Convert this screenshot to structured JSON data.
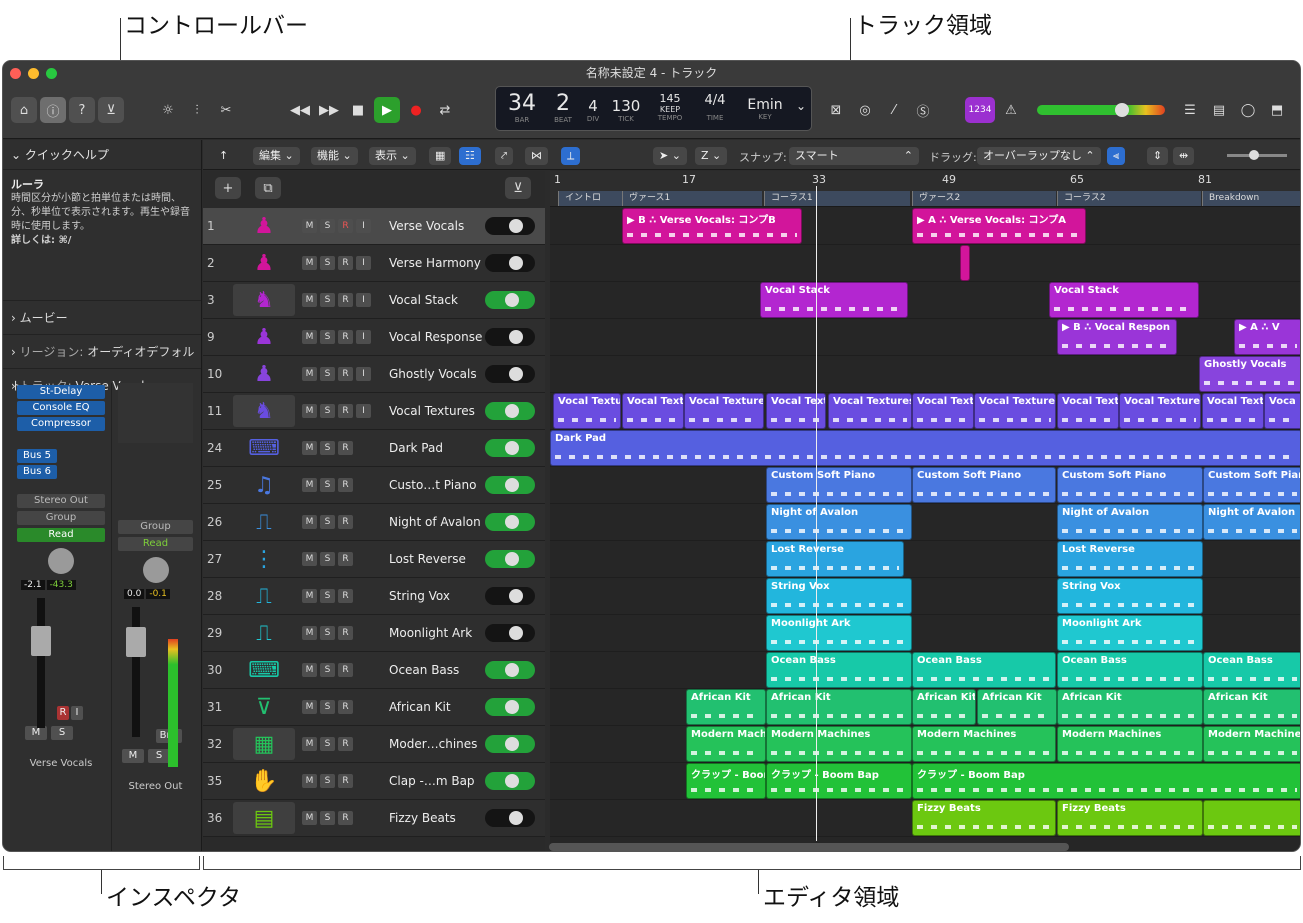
{
  "callouts": {
    "control_bar": "コントロールバー",
    "tracks_area": "トラック領域",
    "inspector": "インスペクタ",
    "editors_area": "エディタ領域"
  },
  "window": {
    "title": "名称未設定 4 - トラック"
  },
  "lcd": {
    "bar": "34",
    "beat": "2",
    "div": "4",
    "tick": "130",
    "bar_l": "BAR",
    "beat_l": "BEAT",
    "div_l": "DIV",
    "tick_l": "TICK",
    "tempo": "145",
    "tempo_mode": "KEEP",
    "tempo_l": "TEMPO",
    "sig": "4/4",
    "time_l": "TIME",
    "key": "Emin",
    "key_l": "KEY"
  },
  "ctrl": {
    "badge": "1234"
  },
  "inspector": {
    "quick_help_title": "クイックヘルプ",
    "help_heading": "ルーラ",
    "help_body": "時間区分が小節と拍単位または時間、分、秒単位で表示されます。再生や録音時に使用します。",
    "help_more": "詳しくは: ⌘/",
    "movie": "ムービー",
    "region_label": "リージョン:",
    "region_value": "オーディオデフォルト",
    "track_label": "トラック:",
    "track_value": "Verse Vocals",
    "strip1": {
      "plugins": [
        "St-Delay",
        "Console EQ",
        "Compressor"
      ],
      "sends": [
        "Bus 5",
        "Bus 6"
      ],
      "output": "Stereo Out",
      "group": "Group",
      "automation": "Read",
      "vol": "-2.1",
      "peak": "-43.3",
      "r": "R",
      "i": "I",
      "m": "M",
      "s": "S",
      "name": "Verse Vocals"
    },
    "strip2": {
      "group": "Group",
      "automation": "Read",
      "vol": "0.0",
      "peak": "-0.1",
      "bnc": "Bnc",
      "m": "M",
      "s": "S",
      "name": "Stereo Out"
    }
  },
  "toolbar": {
    "edit": "編集",
    "functions": "機能",
    "view": "表示",
    "tool": "Z",
    "snap_label": "スナップ:",
    "snap_value": "スマート",
    "drag_label": "ドラッグ:",
    "drag_value": "オーバーラップなし"
  },
  "ruler": {
    "bars": [
      "1",
      "17",
      "33",
      "49",
      "65",
      "81"
    ],
    "markers": [
      "イントロ",
      "ヴァース1",
      "コーラス1",
      "ヴァース2",
      "コーラス2",
      "Breakdown"
    ]
  },
  "tracks": [
    {
      "num": "1",
      "name": "Verse Vocals",
      "color": "#d2159b",
      "icon": "vocal-icon",
      "ri": true,
      "on": false,
      "sel": true
    },
    {
      "num": "2",
      "name": "Verse Harmony",
      "color": "#d2159b",
      "icon": "vocal-icon",
      "ri": true,
      "on": false
    },
    {
      "num": "3",
      "name": "Vocal Stack",
      "color": "#b326d0",
      "icon": "choir-icon",
      "ri": true,
      "on": true,
      "folder": true
    },
    {
      "num": "9",
      "name": "Vocal Response",
      "color": "#9a35d8",
      "icon": "vocal-icon",
      "ri": true,
      "on": false
    },
    {
      "num": "10",
      "name": "Ghostly Vocals",
      "color": "#8844dd",
      "icon": "vocal-icon",
      "ri": true,
      "on": false
    },
    {
      "num": "11",
      "name": "Vocal Textures",
      "color": "#6a4ce0",
      "icon": "choir-icon",
      "ri": true,
      "on": true,
      "folder": true
    },
    {
      "num": "24",
      "name": "Dark Pad",
      "color": "#5560e0",
      "icon": "keyboard-icon",
      "ri": false,
      "on": true
    },
    {
      "num": "25",
      "name": "Custo…t Piano",
      "color": "#4a78e0",
      "icon": "piano-icon",
      "ri": false,
      "on": true
    },
    {
      "num": "26",
      "name": "Night of Avalon",
      "color": "#3a90e0",
      "icon": "synth-icon",
      "ri": false,
      "on": true
    },
    {
      "num": "27",
      "name": "Lost Reverse",
      "color": "#2aa4e0",
      "icon": "sampler-icon",
      "ri": false,
      "on": true
    },
    {
      "num": "28",
      "name": "String Vox",
      "color": "#22b6dd",
      "icon": "synth-icon",
      "ri": false,
      "on": false
    },
    {
      "num": "29",
      "name": "Moonlight Ark",
      "color": "#1fc8d0",
      "icon": "synth-icon",
      "ri": false,
      "on": false
    },
    {
      "num": "30",
      "name": "Ocean Bass",
      "color": "#17c9a8",
      "icon": "keyboard-icon",
      "ri": false,
      "on": true
    },
    {
      "num": "31",
      "name": "African Kit",
      "color": "#22c070",
      "icon": "drum-icon",
      "ri": false,
      "on": true
    },
    {
      "num": "32",
      "name": "Moder…chines",
      "color": "#25c25a",
      "icon": "drum-machine-icon",
      "ri": false,
      "on": true,
      "folder": true
    },
    {
      "num": "35",
      "name": "Clap -…m Bap",
      "color": "#22c238",
      "icon": "clap-icon",
      "ri": false,
      "on": true
    },
    {
      "num": "36",
      "name": "Fizzy Beats",
      "color": "#6cc810",
      "icon": "beat-icon",
      "ri": false,
      "on": false,
      "folder": true
    }
  ],
  "regions": [
    {
      "lane": 0,
      "start": 72,
      "w": 180,
      "label": "▶ B ∴ Verse Vocals: コンプB",
      "color": "#d2159b"
    },
    {
      "lane": 0,
      "start": 362,
      "w": 174,
      "label": "▶ A ∴ Verse Vocals: コンプA",
      "color": "#d2159b"
    },
    {
      "lane": 1,
      "start": 410,
      "w": 10,
      "label": "",
      "color": "#d2159b"
    },
    {
      "lane": 2,
      "start": 210,
      "w": 148,
      "label": "Vocal Stack",
      "color": "#b326d0"
    },
    {
      "lane": 2,
      "start": 499,
      "w": 150,
      "label": "Vocal Stack",
      "color": "#b326d0"
    },
    {
      "lane": 3,
      "start": 507,
      "w": 120,
      "label": "▶ B ∴ Vocal Respon",
      "color": "#9a35d8"
    },
    {
      "lane": 3,
      "start": 684,
      "w": 68,
      "label": "▶ A ∴ V",
      "color": "#9a35d8"
    },
    {
      "lane": 4,
      "start": 649,
      "w": 103,
      "label": "Ghostly Vocals",
      "color": "#8844dd"
    },
    {
      "lane": 5,
      "start": 3,
      "w": 68,
      "label": "Vocal Textu",
      "color": "#6a4ce0"
    },
    {
      "lane": 5,
      "start": 72,
      "w": 62,
      "label": "Vocal Text",
      "color": "#6a4ce0"
    },
    {
      "lane": 5,
      "start": 134,
      "w": 80,
      "label": "Vocal Textures",
      "color": "#6a4ce0"
    },
    {
      "lane": 5,
      "start": 216,
      "w": 60,
      "label": "Vocal Text",
      "color": "#6a4ce0"
    },
    {
      "lane": 5,
      "start": 278,
      "w": 84,
      "label": "Vocal Textures",
      "color": "#6a4ce0"
    },
    {
      "lane": 5,
      "start": 362,
      "w": 62,
      "label": "Vocal Text",
      "color": "#6a4ce0"
    },
    {
      "lane": 5,
      "start": 424,
      "w": 82,
      "label": "Vocal Textures",
      "color": "#6a4ce0"
    },
    {
      "lane": 5,
      "start": 507,
      "w": 62,
      "label": "Vocal Text",
      "color": "#6a4ce0"
    },
    {
      "lane": 5,
      "start": 569,
      "w": 82,
      "label": "Vocal Textures",
      "color": "#6a4ce0"
    },
    {
      "lane": 5,
      "start": 652,
      "w": 62,
      "label": "Vocal Text",
      "color": "#6a4ce0"
    },
    {
      "lane": 5,
      "start": 714,
      "w": 38,
      "label": "Voca",
      "color": "#6a4ce0"
    },
    {
      "lane": 6,
      "start": 0,
      "w": 752,
      "label": "Dark Pad",
      "color": "#5560e0"
    },
    {
      "lane": 7,
      "start": 216,
      "w": 146,
      "label": "Custom Soft Piano",
      "color": "#4a78e0"
    },
    {
      "lane": 7,
      "start": 362,
      "w": 144,
      "label": "Custom Soft Piano",
      "color": "#4a78e0"
    },
    {
      "lane": 7,
      "start": 507,
      "w": 146,
      "label": "Custom Soft Piano",
      "color": "#4a78e0"
    },
    {
      "lane": 7,
      "start": 653,
      "w": 99,
      "label": "Custom Soft Pian",
      "color": "#4a78e0"
    },
    {
      "lane": 8,
      "start": 216,
      "w": 146,
      "label": "Night of Avalon",
      "color": "#3a90e0"
    },
    {
      "lane": 8,
      "start": 507,
      "w": 146,
      "label": "Night of Avalon",
      "color": "#3a90e0"
    },
    {
      "lane": 8,
      "start": 653,
      "w": 99,
      "label": "Night of Avalon",
      "color": "#3a90e0"
    },
    {
      "lane": 9,
      "start": 216,
      "w": 138,
      "label": "Lost Reverse",
      "color": "#2aa4e0"
    },
    {
      "lane": 9,
      "start": 507,
      "w": 146,
      "label": "Lost Reverse",
      "color": "#2aa4e0"
    },
    {
      "lane": 10,
      "start": 216,
      "w": 146,
      "label": "String Vox",
      "color": "#22b6dd"
    },
    {
      "lane": 10,
      "start": 507,
      "w": 146,
      "label": "String Vox",
      "color": "#22b6dd"
    },
    {
      "lane": 11,
      "start": 216,
      "w": 146,
      "label": "Moonlight Ark",
      "color": "#1fc8d0"
    },
    {
      "lane": 11,
      "start": 507,
      "w": 146,
      "label": "Moonlight Ark",
      "color": "#1fc8d0"
    },
    {
      "lane": 12,
      "start": 216,
      "w": 146,
      "label": "Ocean Bass",
      "color": "#17c9a8"
    },
    {
      "lane": 12,
      "start": 362,
      "w": 144,
      "label": "Ocean Bass",
      "color": "#17c9a8"
    },
    {
      "lane": 12,
      "start": 507,
      "w": 146,
      "label": "Ocean Bass",
      "color": "#17c9a8"
    },
    {
      "lane": 12,
      "start": 653,
      "w": 99,
      "label": "Ocean Bass",
      "color": "#17c9a8"
    },
    {
      "lane": 13,
      "start": 136,
      "w": 80,
      "label": "African Kit",
      "color": "#22c070"
    },
    {
      "lane": 13,
      "start": 216,
      "w": 146,
      "label": "African Kit",
      "color": "#22c070"
    },
    {
      "lane": 13,
      "start": 362,
      "w": 64,
      "label": "African Kit",
      "color": "#22c070"
    },
    {
      "lane": 13,
      "start": 427,
      "w": 80,
      "label": "African Kit",
      "color": "#22c070"
    },
    {
      "lane": 13,
      "start": 507,
      "w": 146,
      "label": "African Kit",
      "color": "#22c070"
    },
    {
      "lane": 13,
      "start": 653,
      "w": 99,
      "label": "African Kit",
      "color": "#22c070"
    },
    {
      "lane": 14,
      "start": 136,
      "w": 80,
      "label": "Modern Machin",
      "color": "#25c25a"
    },
    {
      "lane": 14,
      "start": 216,
      "w": 146,
      "label": "Modern Machines",
      "color": "#25c25a"
    },
    {
      "lane": 14,
      "start": 362,
      "w": 144,
      "label": "Modern Machines",
      "color": "#25c25a"
    },
    {
      "lane": 14,
      "start": 507,
      "w": 146,
      "label": "Modern Machines",
      "color": "#25c25a"
    },
    {
      "lane": 14,
      "start": 653,
      "w": 99,
      "label": "Modern Machines",
      "color": "#25c25a"
    },
    {
      "lane": 15,
      "start": 136,
      "w": 80,
      "label": "クラップ - Boon",
      "color": "#22c238"
    },
    {
      "lane": 15,
      "start": 216,
      "w": 146,
      "label": "クラップ - Boom Bap",
      "color": "#22c238"
    },
    {
      "lane": 15,
      "start": 362,
      "w": 390,
      "label": "クラップ - Boom Bap",
      "color": "#22c238"
    },
    {
      "lane": 16,
      "start": 362,
      "w": 144,
      "label": "Fizzy Beats",
      "color": "#6cc810"
    },
    {
      "lane": 16,
      "start": 507,
      "w": 146,
      "label": "Fizzy Beats",
      "color": "#6cc810"
    },
    {
      "lane": 16,
      "start": 653,
      "w": 99,
      "label": "",
      "color": "#6cc810"
    }
  ]
}
